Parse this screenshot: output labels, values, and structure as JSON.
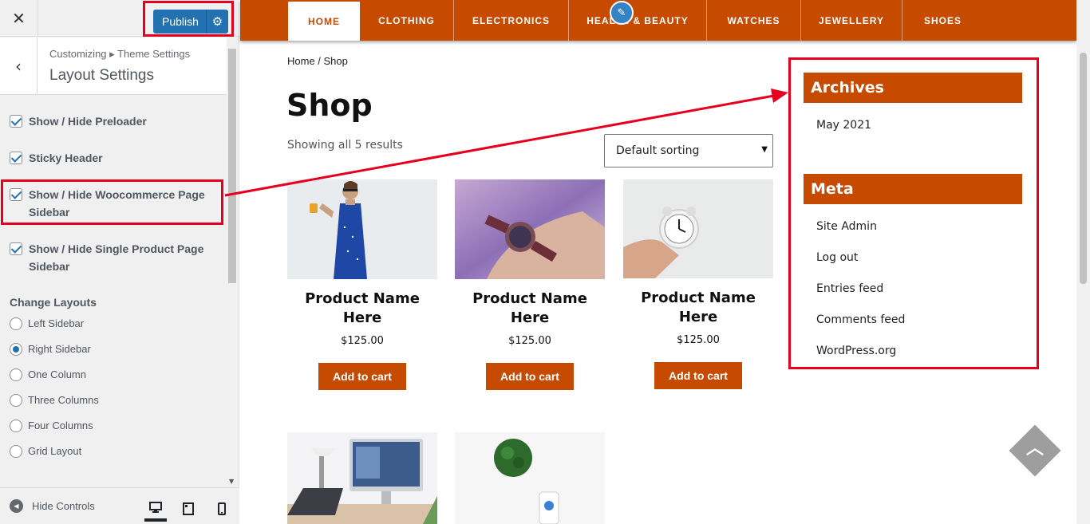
{
  "customizer": {
    "publish_label": "Publish",
    "breadcrumb": "Customizing ▸ Theme Settings",
    "section_title": "Layout Settings",
    "checkboxes": [
      {
        "label": "Show / Hide Preloader",
        "checked": true
      },
      {
        "label": "Sticky Header",
        "checked": true
      },
      {
        "label": "Show / Hide Woocommerce Page Sidebar",
        "checked": true
      },
      {
        "label": "Show / Hide Single Product Page Sidebar",
        "checked": true
      }
    ],
    "layouts_heading": "Change Layouts",
    "layouts": [
      {
        "label": "Left Sidebar",
        "selected": false
      },
      {
        "label": "Right Sidebar",
        "selected": true
      },
      {
        "label": "One Column",
        "selected": false
      },
      {
        "label": "Three Columns",
        "selected": false
      },
      {
        "label": "Four Columns",
        "selected": false
      },
      {
        "label": "Grid Layout",
        "selected": false
      }
    ],
    "hide_controls_label": "Hide Controls",
    "devices": [
      "desktop-icon",
      "tablet-icon",
      "mobile-icon"
    ]
  },
  "site": {
    "nav": [
      "HOME",
      "CLOTHING",
      "ELECTRONICS",
      "HEALTH & BEAUTY",
      "WATCHES",
      "JEWELLERY",
      "SHOES"
    ],
    "nav_active": "HOME",
    "breadcrumb": "Home / Shop",
    "page_title": "Shop",
    "result_count": "Showing all 5 results",
    "sort_value": "Default sorting",
    "products": [
      {
        "name": "Product Name Here",
        "price": "$125.00",
        "button": "Add to cart",
        "image": "woman-in-blue-dress"
      },
      {
        "name": "Product Name Here",
        "price": "$125.00",
        "button": "Add to cart",
        "image": "wrist-watch"
      },
      {
        "name": "Product Name Here",
        "price": "$125.00",
        "button": "Add to cart",
        "image": "alarm-clock-in-hand"
      },
      {
        "image": "desk-with-laptop-and-monitor"
      },
      {
        "image": "plant-and-phone"
      }
    ],
    "archives": {
      "title": "Archives",
      "links": [
        "May 2021"
      ]
    },
    "meta": {
      "title": "Meta",
      "links": [
        "Site Admin",
        "Log out",
        "Entries feed",
        "Comments feed",
        "WordPress.org"
      ]
    }
  },
  "colors": {
    "brand": "#c64b00",
    "wp_blue": "#2271b1",
    "annotation_red": "#e5001f"
  }
}
